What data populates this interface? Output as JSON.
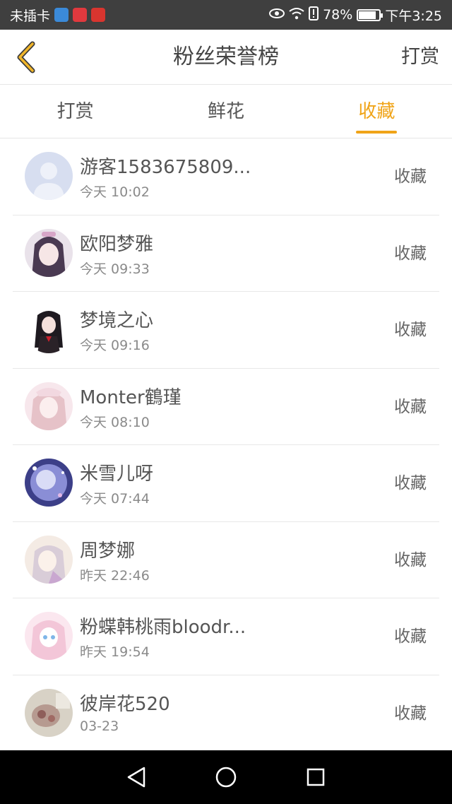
{
  "status_bar": {
    "carrier": "未插卡",
    "battery_percent": "78%",
    "battery_level": 0.78,
    "time": "下午3:25",
    "icons": [
      "app-browser-icon",
      "app-mall-icon",
      "app-reader-icon",
      "eye-icon",
      "wifi-icon",
      "alert-icon",
      "battery-icon"
    ]
  },
  "nav": {
    "back_icon": "chevron-left-icon",
    "title": "粉丝荣誉榜",
    "action_label": "打赏"
  },
  "tabs": [
    {
      "label": "打赏",
      "active": false
    },
    {
      "label": "鲜花",
      "active": false
    },
    {
      "label": "收藏",
      "active": true
    }
  ],
  "accent_color": "#f0a418",
  "fans": [
    {
      "name": "游客1583675809...",
      "time": "今天 10:02",
      "tag": "收藏",
      "avatar": "default-avatar"
    },
    {
      "name": "欧阳梦雅",
      "time": "今天 09:33",
      "tag": "收藏",
      "avatar": "anime-girl-avatar"
    },
    {
      "name": "梦境之心",
      "time": "今天 09:16",
      "tag": "收藏",
      "avatar": "anime-girl-avatar"
    },
    {
      "name": "Monter鶴瑾",
      "time": "今天 08:10",
      "tag": "收藏",
      "avatar": "anime-girl-avatar"
    },
    {
      "name": "米雪儿呀",
      "time": "今天 07:44",
      "tag": "收藏",
      "avatar": "anime-girl-avatar"
    },
    {
      "name": "周梦娜",
      "time": "昨天 22:46",
      "tag": "收藏",
      "avatar": "anime-girl-avatar"
    },
    {
      "name": "粉蝶韩桃雨bloodr...",
      "time": "昨天 19:54",
      "tag": "收藏",
      "avatar": "anime-girl-avatar"
    },
    {
      "name": "彼岸花520",
      "time": "03-23",
      "tag": "收藏",
      "avatar": "photo-avatar"
    }
  ],
  "system_nav": [
    "back-triangle-icon",
    "home-circle-icon",
    "recents-square-icon"
  ]
}
